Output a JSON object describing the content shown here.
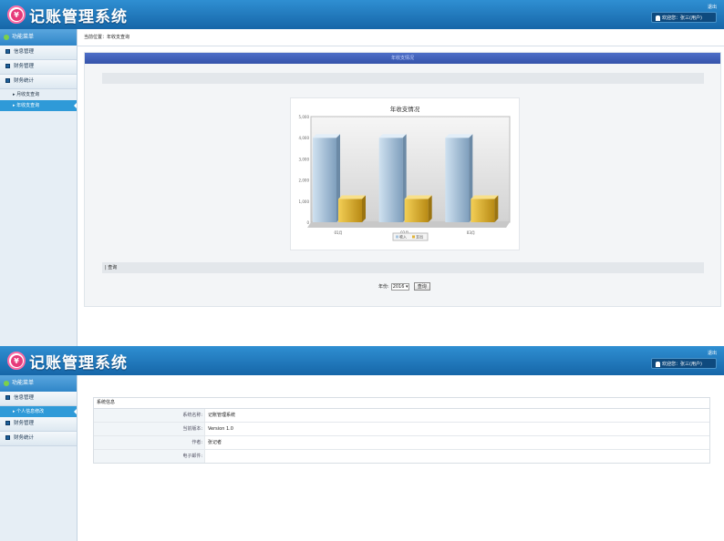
{
  "app": {
    "title": "记账管理系统",
    "logo_glyph": "¥",
    "logout": "退出",
    "welcome": "欢迎您：张三(用户)"
  },
  "sidebar": {
    "header": "功能菜单",
    "frame1": {
      "items": [
        {
          "label": "信息管理"
        },
        {
          "label": "财务管理"
        },
        {
          "label": "财务统计",
          "children": [
            {
              "label": "月收支查询"
            },
            {
              "label": "年收支查询",
              "active": true
            }
          ]
        }
      ]
    },
    "frame2": {
      "items": [
        {
          "label": "信息管理",
          "children": [
            {
              "label": "个人信息修改",
              "active": true
            }
          ]
        },
        {
          "label": "财务管理"
        },
        {
          "label": "财务统计"
        }
      ]
    }
  },
  "breadcrumb": "当前位置：年收支查询",
  "panel": {
    "title": "年收支情况",
    "query_label": "| 查询",
    "year_label": "年份:",
    "year_value": "2016",
    "query_button": "查询"
  },
  "chart_data": {
    "type": "bar",
    "title": "年收支情况",
    "categories": [
      "01月",
      "02月",
      "03月"
    ],
    "series": [
      {
        "name": "收入",
        "values": [
          4000,
          4000,
          4000
        ],
        "color": "#a9c6e0"
      },
      {
        "name": "支出",
        "values": [
          1100,
          1100,
          1100
        ],
        "color": "#e1b43a"
      }
    ],
    "ylim": [
      0,
      5000
    ],
    "yticks": [
      "0",
      "1,000",
      "2,000",
      "3,000",
      "4,000",
      "5,000"
    ],
    "grid": false,
    "legend": "bottom"
  },
  "system_info": {
    "title": "系统信息",
    "rows": [
      {
        "k": "系统名称:",
        "v": "记账管理系统"
      },
      {
        "k": "当前版本:",
        "v": "Version 1.0"
      },
      {
        "k": "作者:",
        "v": "张记者"
      },
      {
        "k": "电子邮件:",
        "v": ""
      }
    ]
  }
}
